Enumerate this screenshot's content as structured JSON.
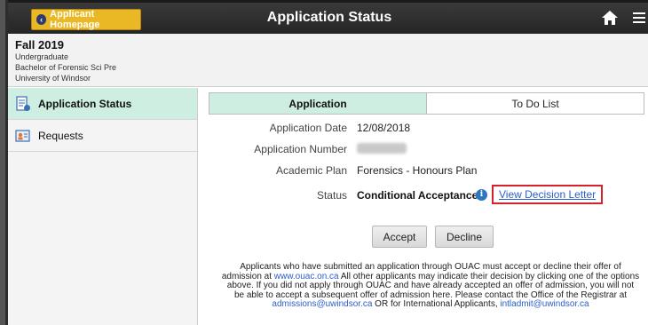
{
  "topbar": {
    "home_button_label": "Applicant Homepage",
    "title": "Application Status",
    "icons": [
      "chevron-left-icon",
      "home-icon",
      "hamburger-menu-icon"
    ]
  },
  "info": {
    "term": "Fall 2019",
    "career": "Undergraduate",
    "program": "Bachelor of Forensic Sci Pre",
    "institution": "University of Windsor"
  },
  "sidebar": {
    "items": [
      {
        "label": "Application Status",
        "icon": "document-status-icon",
        "active": true
      },
      {
        "label": "Requests",
        "icon": "requests-icon",
        "active": false
      }
    ]
  },
  "tabs": [
    {
      "label": "Application",
      "active": true
    },
    {
      "label": "To Do List",
      "active": false
    }
  ],
  "details": {
    "app_date_label": "Application Date",
    "app_date_value": "12/08/2018",
    "app_number_label": "Application Number",
    "academic_plan_label": "Academic Plan",
    "academic_plan_value": "Forensics - Honours Plan",
    "status_label": "Status",
    "status_value": "Conditional Acceptance",
    "decision_link": "View Decision Letter"
  },
  "actions": {
    "accept": "Accept",
    "decline": "Decline"
  },
  "notice": {
    "part1": "Applicants who have submitted an application through OUAC must accept or decline their offer of admission at ",
    "link1": "www.ouac.on.ca",
    "part2": " All other applicants may indicate their decision by clicking one of the options above. If you did not apply through OUAC and have already accepted an offer of admission, you will not be able to accept a subsequent offer of admission here. Please contact the Office of the Registrar at ",
    "link2": "admissions@uwindsor.ca",
    "part3": " OR for International Applicants, ",
    "link3": "intladmit@uwindsor.ca"
  },
  "colors": {
    "accent_gold": "#e9b824",
    "active_green": "#cdeee0",
    "link_blue": "#2a5fc9",
    "highlight_red": "#d6202a"
  }
}
